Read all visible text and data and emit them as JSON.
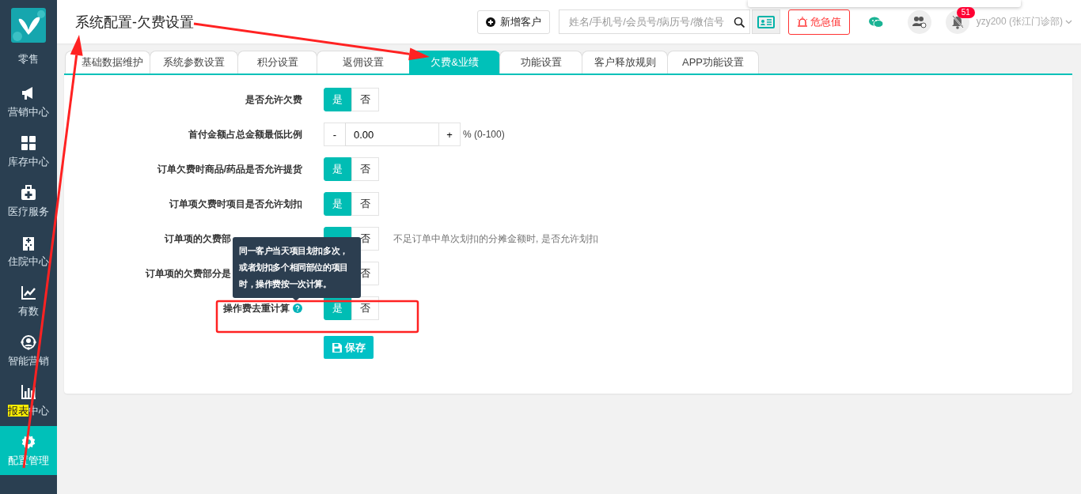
{
  "sidebar": {
    "items": [
      {
        "label_parts": [
          {
            "text": "零售",
            "highlighted": false
          }
        ],
        "selected": false
      },
      {
        "label_parts": [
          {
            "text": "营销中心",
            "highlighted": false
          }
        ],
        "selected": false
      },
      {
        "label_parts": [
          {
            "text": "库存中心",
            "highlighted": false
          }
        ],
        "selected": false
      },
      {
        "label_parts": [
          {
            "text": "医疗服务",
            "highlighted": false
          }
        ],
        "selected": false
      },
      {
        "label_parts": [
          {
            "text": "住院中心",
            "highlighted": false
          }
        ],
        "selected": false
      },
      {
        "label_parts": [
          {
            "text": "有数",
            "highlighted": false
          }
        ],
        "selected": false
      },
      {
        "label_parts": [
          {
            "text": "智能营销",
            "highlighted": false
          }
        ],
        "selected": false
      },
      {
        "label_parts": [
          {
            "text": "报表",
            "highlighted": true
          },
          {
            "text": "中心",
            "highlighted": false
          }
        ],
        "selected": false
      },
      {
        "label_parts": [
          {
            "text": "配置管理",
            "highlighted": false
          }
        ],
        "selected": true
      }
    ]
  },
  "header": {
    "title": "系统配置-欠费设置",
    "new_customer_button": "新增客户",
    "search": {
      "placeholder": "姓名/手机号/会员号/病历号/微信号"
    },
    "alert_button": "危急值",
    "notification_badge": "51",
    "user": "yzy200 (张江门诊部)"
  },
  "tabs": [
    {
      "label": "基础数据维护",
      "selected": false
    },
    {
      "label": "系统参数设置",
      "selected": false
    },
    {
      "label": "积分设置",
      "selected": false
    },
    {
      "label": "返佣设置",
      "selected": false
    },
    {
      "label": "欠费&业绩",
      "selected": true
    },
    {
      "label": "功能设置",
      "selected": false
    },
    {
      "label": "客户释放规则",
      "selected": false
    },
    {
      "label": "APP功能设置",
      "selected": false
    }
  ],
  "form": {
    "rows": [
      {
        "kind": "toggle",
        "label": "是否允许欠费",
        "options": [
          {
            "label": "是",
            "selected": true
          },
          {
            "label": "否",
            "selected": false
          }
        ]
      },
      {
        "kind": "stepper",
        "label": "首付金额占总金额最低比例",
        "minus": "-",
        "value": "0.00",
        "plus": "+",
        "unit": "% (0-100)"
      },
      {
        "kind": "toggle",
        "label": "订单欠费时商品/药品是否允许提货",
        "options": [
          {
            "label": "是",
            "selected": true
          },
          {
            "label": "否",
            "selected": false
          }
        ]
      },
      {
        "kind": "toggle",
        "label": "订单项欠费时项目是否允许划扣",
        "options": [
          {
            "label": "是",
            "selected": true
          },
          {
            "label": "否",
            "selected": false
          }
        ]
      },
      {
        "kind": "toggle",
        "label": "订单项的欠费部",
        "cut_by_tooltip": true,
        "options": [
          {
            "selected": true
          },
          {
            "label": "否",
            "selected": false
          }
        ],
        "hint": "不足订单中单次划扣的分摊金额时, 是否允许划扣"
      },
      {
        "kind": "toggle",
        "label": "订单项的欠费部分是",
        "cut_by_tooltip": true,
        "options": [
          {
            "label": "否",
            "selected": false
          }
        ]
      },
      {
        "kind": "toggle",
        "label": "操作费去重计算",
        "help": true,
        "options": [
          {
            "label": "是",
            "selected": true
          },
          {
            "label": "否",
            "selected": false
          }
        ]
      }
    ],
    "save_button": "保存",
    "tooltip": "同一客户当天项目划扣多次，或者划扣多个相同部位的项目时，操作费按一次计算。"
  },
  "annotations": [
    {
      "kind": "arrow"
    },
    {
      "kind": "arrow"
    },
    {
      "kind": "frame"
    }
  ]
}
